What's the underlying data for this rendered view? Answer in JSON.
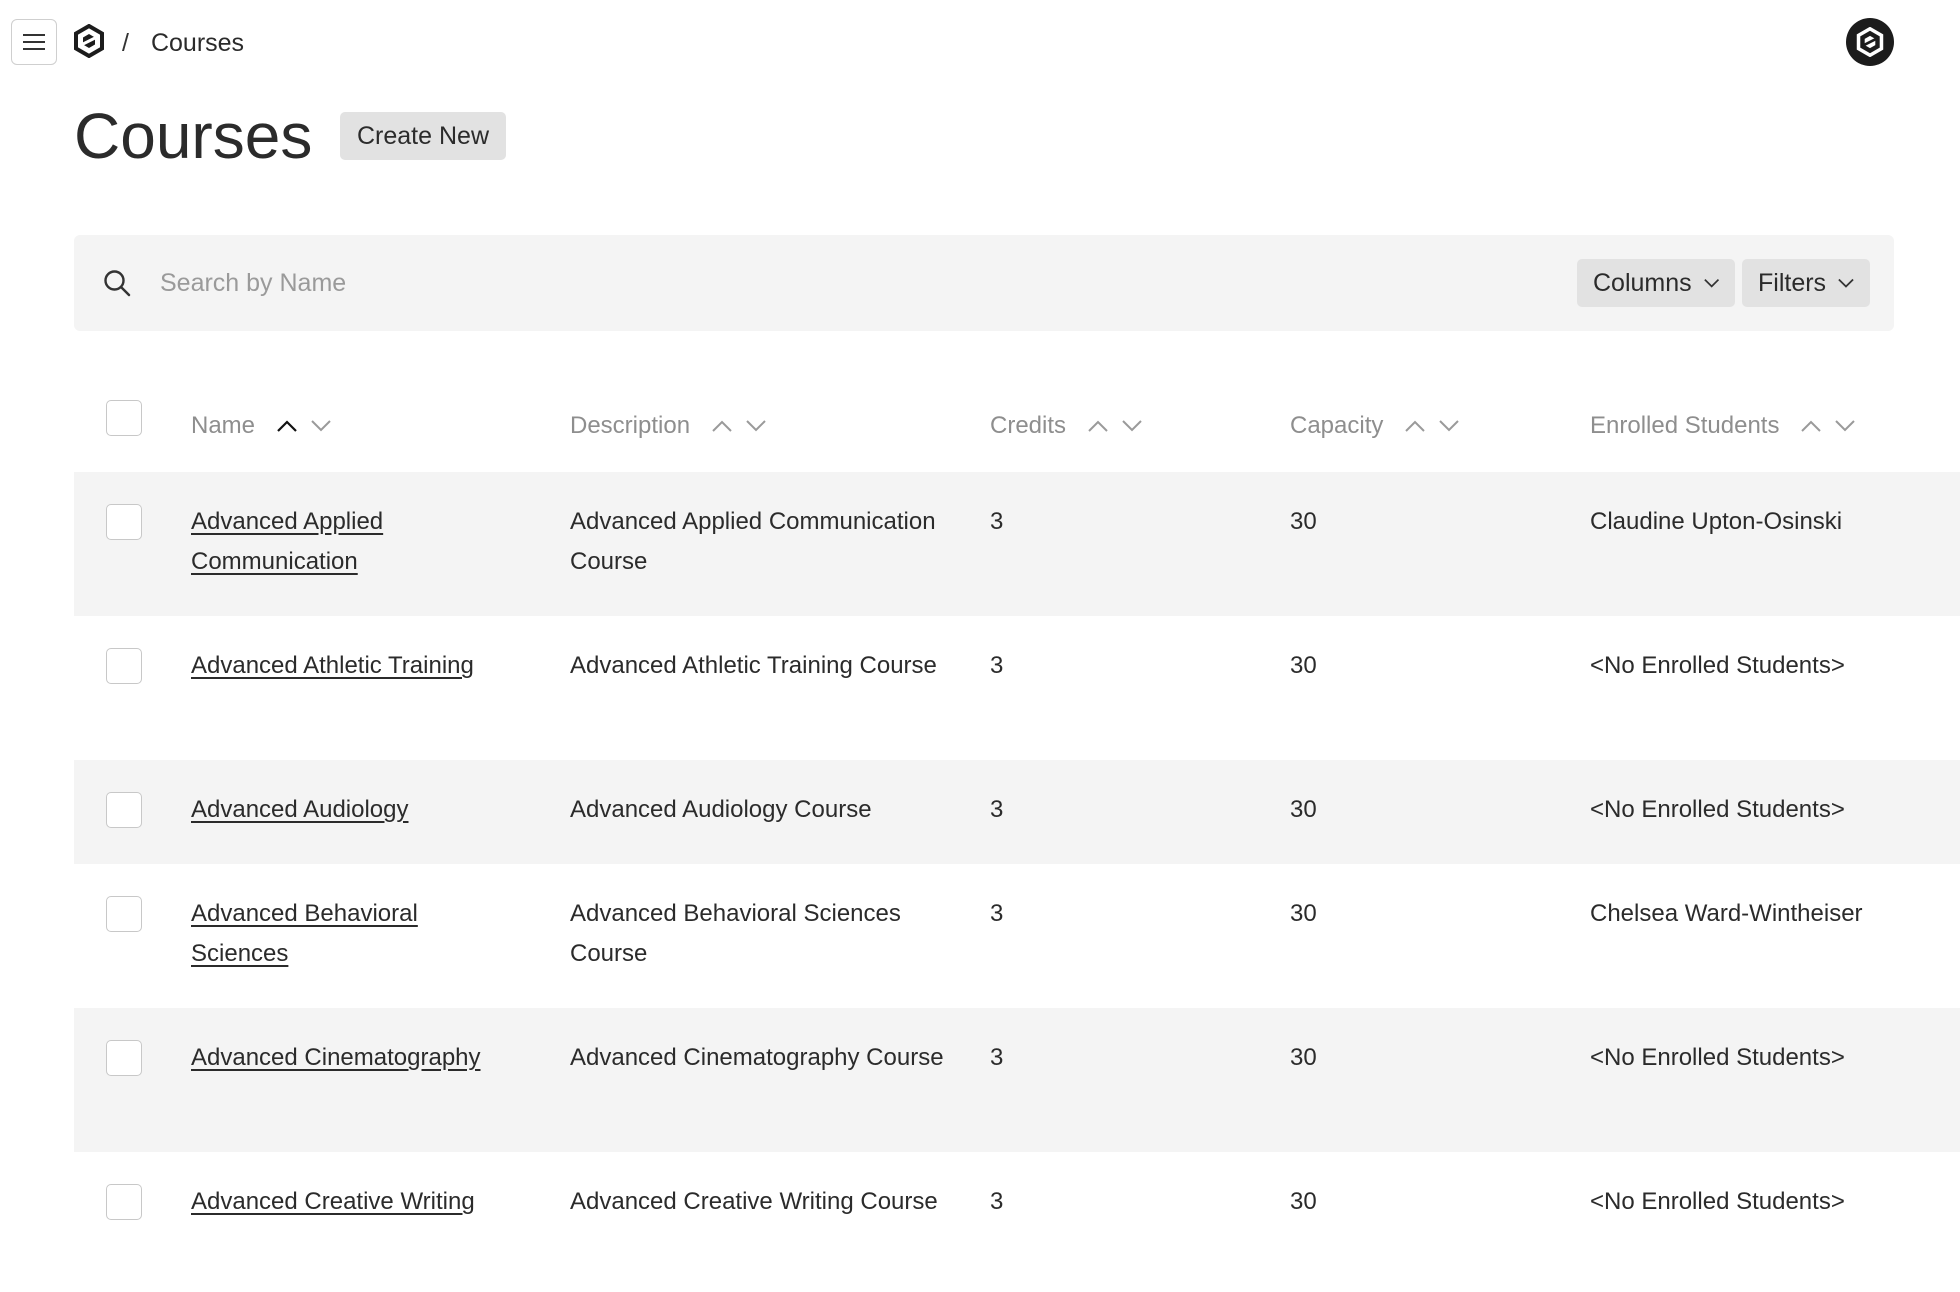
{
  "breadcrumb": {
    "separator": "/",
    "current": "Courses"
  },
  "page": {
    "title": "Courses",
    "create_label": "Create New"
  },
  "search": {
    "placeholder": "Search by Name",
    "value": ""
  },
  "toolbar": {
    "columns_label": "Columns",
    "filters_label": "Filters"
  },
  "table": {
    "columns": [
      "Name",
      "Description",
      "Credits",
      "Capacity",
      "Enrolled Students"
    ],
    "rows": [
      {
        "name": "Advanced Applied Communication",
        "description": "Advanced Applied Communication Course",
        "credits": "3",
        "capacity": "30",
        "enrolled": "Claudine Upton-Osinski"
      },
      {
        "name": "Advanced Athletic Training",
        "description": "Advanced Athletic Training Course",
        "credits": "3",
        "capacity": "30",
        "enrolled": "<No Enrolled Students>"
      },
      {
        "name": "Advanced Audiology",
        "description": "Advanced Audiology Course",
        "credits": "3",
        "capacity": "30",
        "enrolled": "<No Enrolled Students>"
      },
      {
        "name": "Advanced Behavioral Sciences",
        "description": "Advanced Behavioral Sciences Course",
        "credits": "3",
        "capacity": "30",
        "enrolled": "Chelsea Ward-Wintheiser"
      },
      {
        "name": "Advanced Cinematography",
        "description": "Advanced Cinematography Course",
        "credits": "3",
        "capacity": "30",
        "enrolled": "<No Enrolled Students>"
      },
      {
        "name": "Advanced Creative Writing",
        "description": "Advanced Creative Writing Course",
        "credits": "3",
        "capacity": "30",
        "enrolled": "<No Enrolled Students>"
      }
    ]
  },
  "icons": {
    "menu": "hamburger-menu-icon",
    "logo": "hexagon-logo-icon",
    "search": "search-icon",
    "sort_asc": "chevron-up-icon",
    "sort_desc": "chevron-down-icon"
  },
  "colors": {
    "text": "#2b2b2b",
    "muted": "#8e8e8e",
    "row_alt": "#f4f4f4",
    "button_bg": "#e2e2e2",
    "avatar_bg": "#1c1c1c"
  }
}
